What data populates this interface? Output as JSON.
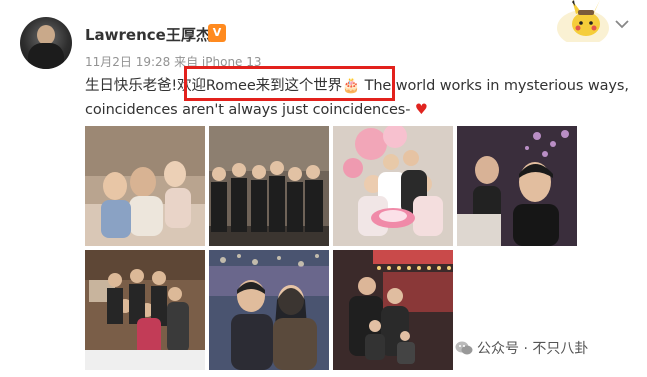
{
  "post": {
    "username": "Lawrence王厚杰",
    "badge_icon": "vip-badge-icon",
    "meta": "11月2日 19:28 来自 iPhone 13",
    "text_part1": "生日快乐老爸!",
    "text_highlight": "欢迎Romee来到这个世界",
    "text_part2": "The world works in mysterious ways, coincidences aren't always just coincidences-",
    "heart_glyph": "♥",
    "cake_glyph": "🎂"
  },
  "photos": [
    {
      "name": "family-photo-1"
    },
    {
      "name": "group-photo-suits"
    },
    {
      "name": "birthday-balloons-photo"
    },
    {
      "name": "selfie-photo"
    },
    {
      "name": "family-dinner-photo"
    },
    {
      "name": "couple-dinner-photo"
    },
    {
      "name": "carousel-family-photo"
    }
  ],
  "watermark": {
    "text": "公众号 · 不只八卦"
  },
  "colors": {
    "highlight_border": "#e2211c",
    "text": "#333333",
    "meta": "#939393",
    "heart": "#e0241f"
  }
}
